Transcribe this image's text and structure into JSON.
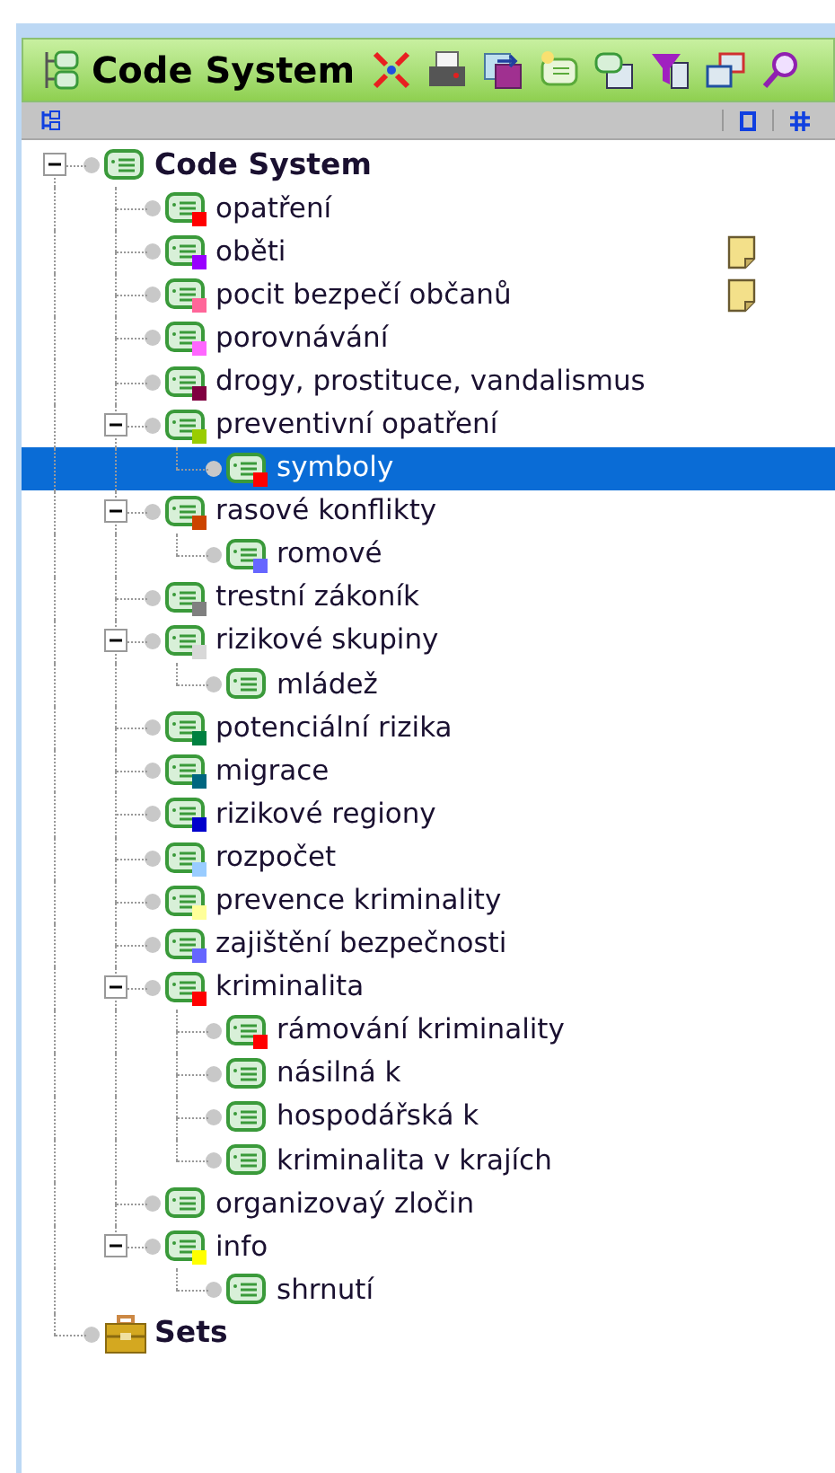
{
  "header": {
    "title": "Code System"
  },
  "tree": [
    {
      "label": "Code System",
      "kind": "root",
      "expanded": true,
      "selected": false,
      "memo": false,
      "children": [
        {
          "label": "opatření",
          "kind": "code",
          "color": "#ff0000",
          "selected": false,
          "memo": false
        },
        {
          "label": "oběti",
          "kind": "code",
          "color": "#9900ff",
          "selected": false,
          "memo": true
        },
        {
          "label": "pocit bezpečí občanů",
          "kind": "code",
          "color": "#ff6699",
          "selected": false,
          "memo": true
        },
        {
          "label": "porovnávání",
          "kind": "code",
          "color": "#ff66ff",
          "selected": false,
          "memo": false
        },
        {
          "label": "drogy, prostituce, vandalismus",
          "kind": "code",
          "color": "#800040",
          "selected": false,
          "memo": false
        },
        {
          "label": "preventivní opatření",
          "kind": "code",
          "color": "#99cc00",
          "expanded": true,
          "selected": false,
          "memo": false,
          "children": [
            {
              "label": "symboly",
              "kind": "code",
              "color": "#ff0000",
              "selected": true,
              "memo": false
            }
          ]
        },
        {
          "label": "rasové konflikty",
          "kind": "code",
          "color": "#cc4400",
          "expanded": true,
          "selected": false,
          "memo": false,
          "children": [
            {
              "label": "romové",
              "kind": "code",
              "color": "#6666ff",
              "selected": false,
              "memo": false
            }
          ]
        },
        {
          "label": "trestní zákoník",
          "kind": "code",
          "color": "#808080",
          "selected": false,
          "memo": false
        },
        {
          "label": "rizikové skupiny",
          "kind": "code",
          "color": "#d8d8d8",
          "expanded": true,
          "selected": false,
          "memo": false,
          "children": [
            {
              "label": "mládež",
              "kind": "code",
              "selected": false,
              "memo": false
            }
          ]
        },
        {
          "label": "potenciální rizika",
          "kind": "code",
          "color": "#008040",
          "selected": false,
          "memo": false
        },
        {
          "label": "migrace",
          "kind": "code",
          "color": "#006680",
          "selected": false,
          "memo": false
        },
        {
          "label": "rizikové regiony",
          "kind": "code",
          "color": "#0000cc",
          "selected": false,
          "memo": false
        },
        {
          "label": "rozpočet",
          "kind": "code",
          "color": "#99ccff",
          "selected": false,
          "memo": false
        },
        {
          "label": "prevence kriminality",
          "kind": "code",
          "color": "#ffff99",
          "selected": false,
          "memo": false
        },
        {
          "label": "zajištění bezpečnosti",
          "kind": "code",
          "color": "#6666ff",
          "selected": false,
          "memo": false
        },
        {
          "label": "kriminalita",
          "kind": "code",
          "color": "#ff0000",
          "expanded": true,
          "selected": false,
          "memo": false,
          "children": [
            {
              "label": "rámování kriminality",
              "kind": "code",
              "color": "#ff0000",
              "selected": false,
              "memo": false
            },
            {
              "label": "násilná k",
              "kind": "code",
              "selected": false,
              "memo": false
            },
            {
              "label": "hospodářská k",
              "kind": "code",
              "selected": false,
              "memo": false
            },
            {
              "label": "kriminalita v krajích",
              "kind": "code",
              "selected": false,
              "memo": false
            }
          ]
        },
        {
          "label": "organizovaý zločin",
          "kind": "code",
          "selected": false,
          "memo": false
        },
        {
          "label": "info",
          "kind": "code",
          "color": "#ffff00",
          "expanded": true,
          "selected": false,
          "memo": false,
          "children": [
            {
              "label": "shrnutí",
              "kind": "code",
              "selected": false,
              "memo": false
            }
          ]
        }
      ]
    },
    {
      "label": "Sets",
      "kind": "sets",
      "selected": false,
      "memo": false
    }
  ]
}
